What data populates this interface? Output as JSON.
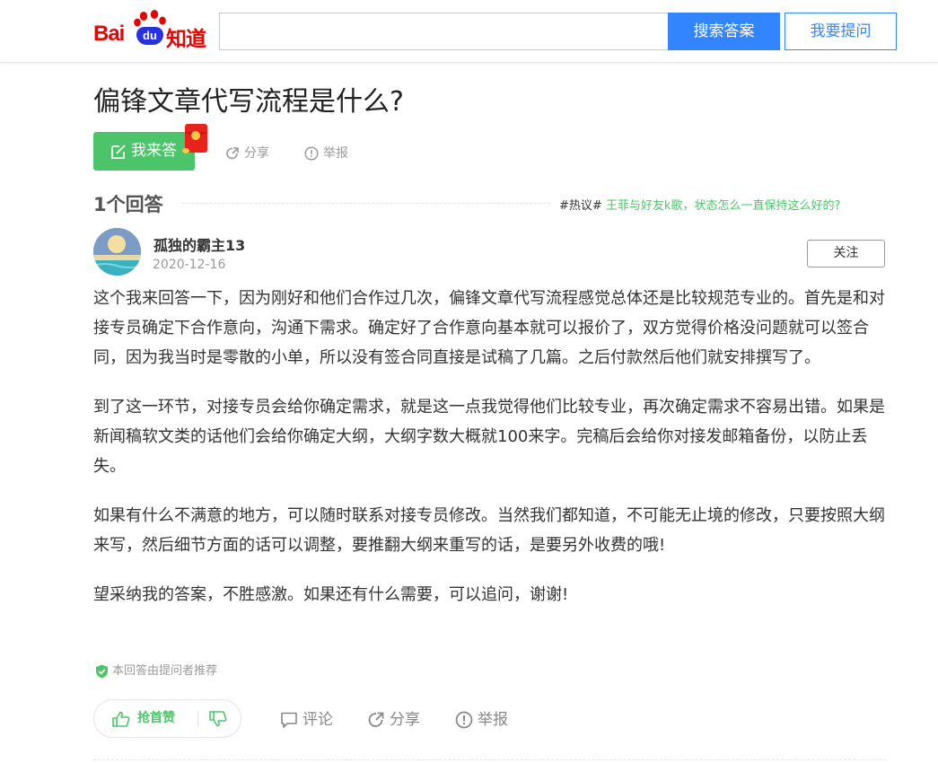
{
  "header": {
    "logo": {
      "bai": "Bai",
      "du": "du",
      "zhidao": "知道"
    },
    "search": {
      "placeholder": "",
      "value": ""
    },
    "search_button": "搜索答案",
    "ask_button": "我要提问"
  },
  "question": {
    "title": "偏锋文章代写流程是什么?",
    "answer_button": "我来答",
    "share": "分享",
    "report": "举报"
  },
  "answers_header": {
    "count": "1个回答",
    "hot_tag": "#热议#",
    "hot_link": " 王菲与好友k歌，状态怎么一直保持这么好的?"
  },
  "answer": {
    "author": "孤独的霸主13",
    "date": "2020-12-16",
    "follow": "关注",
    "paragraphs": [
      "这个我来回答一下，因为刚好和他们合作过几次，偏锋文章代写流程感觉总体还是比较规范专业的。首先是和对接专员确定下合作意向，沟通下需求。确定好了合作意向基本就可以报价了，双方觉得价格没问题就可以签合同，因为我当时是零散的小单，所以没有签合同直接是试稿了几篇。之后付款然后他们就安排撰写了。",
      "到了这一环节，对接专员会给你确定需求，就是这一点我觉得他们比较专业，再次确定需求不容易出错。如果是新闻稿软文类的话他们会给你确定大纲，大纲字数大概就100来字。完稿后会给你对接发邮箱备份，以防止丢失。",
      "如果有什么不满意的地方，可以随时联系对接专员修改。当然我们都知道，不可能无止境的修改，只要按照大纲来写，然后细节方面的话可以调整，要推翻大纲来重写的话，是要另外收费的哦!",
      "望采纳我的答案，不胜感激。如果还有什么需要，可以追问，谢谢!"
    ],
    "recommend": "本回答由提问者推荐",
    "vote_up": "抢首赞",
    "comment": "评论",
    "share": "分享",
    "report": "举报"
  },
  "colors": {
    "brand_red": "#e10602",
    "brand_blue": "#2932e1",
    "search_blue": "#3385ff",
    "green": "#4cc56a"
  },
  "icons": [
    "baidu-paw-icon",
    "edit-icon",
    "red-envelope-icon",
    "share-icon",
    "report-icon",
    "shield-check-icon",
    "thumbs-up-icon",
    "thumbs-down-icon",
    "comment-icon"
  ]
}
